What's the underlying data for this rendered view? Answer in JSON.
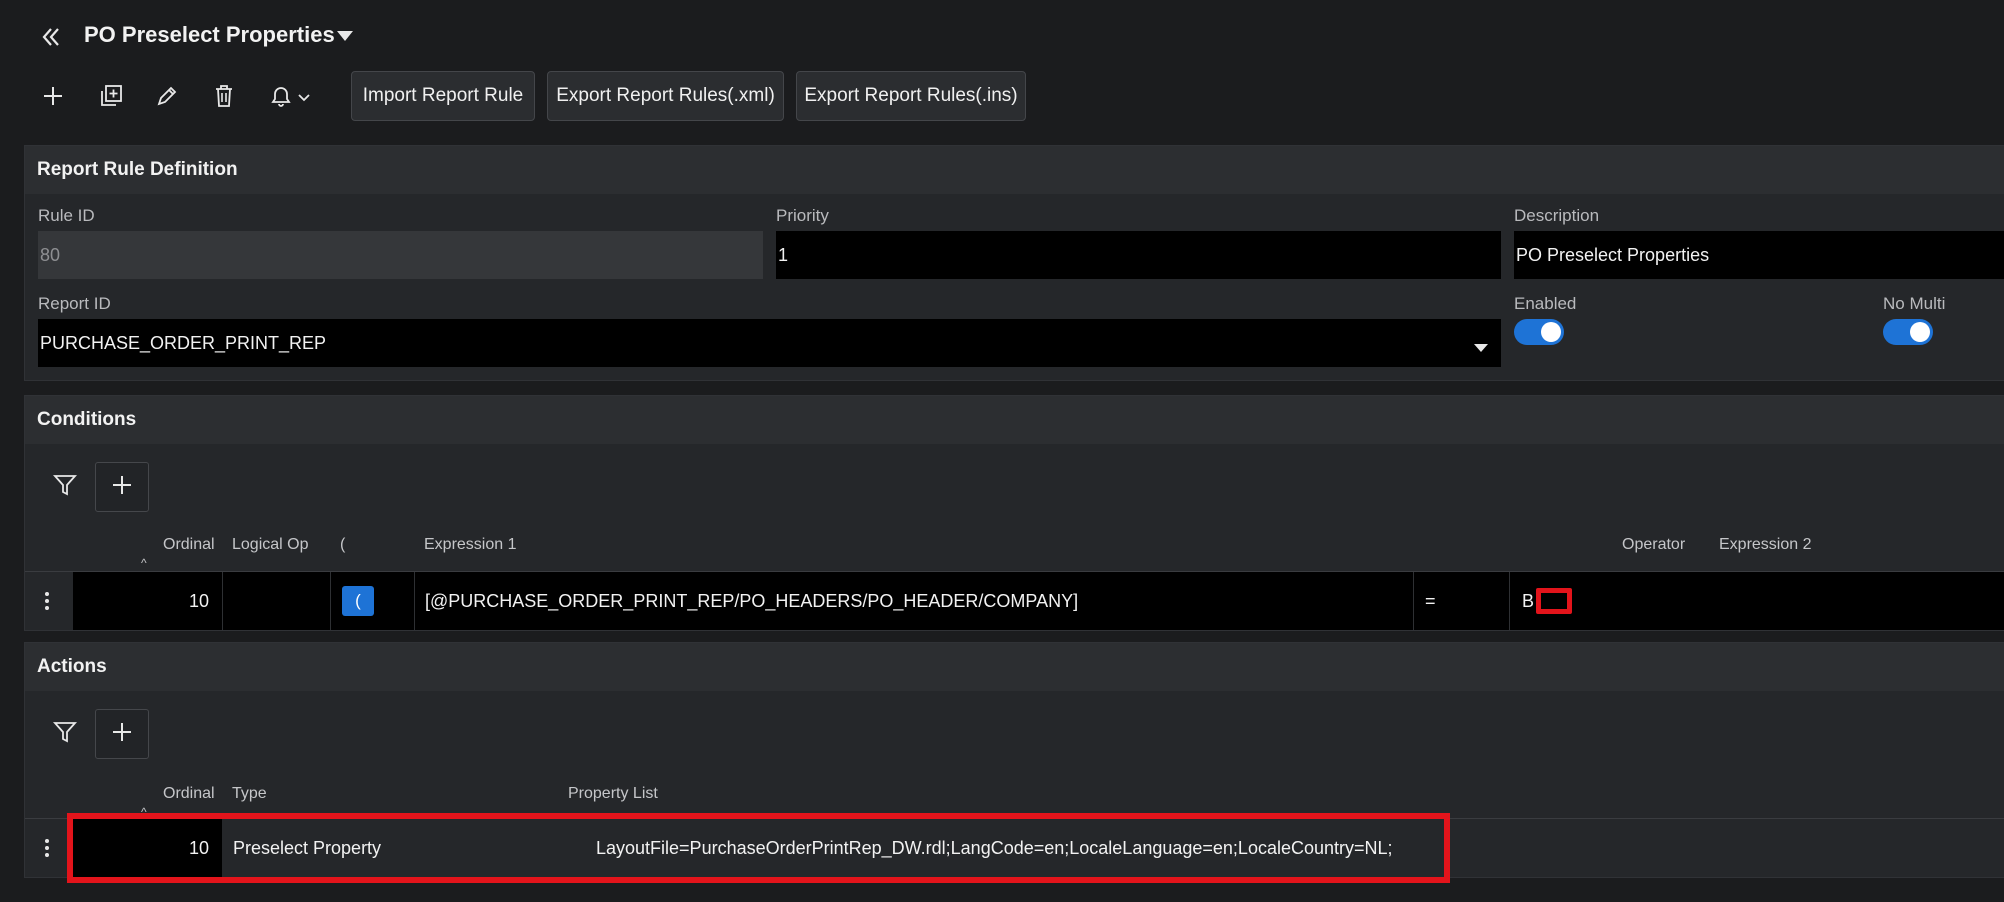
{
  "header": {
    "title": "PO Preselect Properties"
  },
  "toolbar": {
    "import_label": "Import Report Rule",
    "export_xml_label": "Export Report Rules(.xml)",
    "export_ins_label": "Export Report Rules(.ins)"
  },
  "definition": {
    "title": "Report Rule Definition",
    "rule_id_label": "Rule ID",
    "rule_id_value": "80",
    "priority_label": "Priority",
    "priority_value": "1",
    "description_label": "Description",
    "description_value": "PO Preselect Properties",
    "report_id_label": "Report ID",
    "report_id_value": "PURCHASE_ORDER_PRINT_REP",
    "enabled_label": "Enabled",
    "enabled_state": "on",
    "no_multi_label": "No Multi",
    "no_multi_state": "on"
  },
  "conditions": {
    "title": "Conditions",
    "columns": [
      "Ordinal",
      "Logical Op",
      "(",
      "Expression 1",
      "Operator",
      "Expression 2"
    ],
    "rows": [
      {
        "ordinal": "10",
        "logical_op": "",
        "paren": "(",
        "expression1": "[@PURCHASE_ORDER_PRINT_REP/PO_HEADERS/PO_HEADER/COMPANY]",
        "operator": "=",
        "expression2": "B"
      }
    ]
  },
  "actions": {
    "title": "Actions",
    "columns": [
      "Ordinal",
      "Type",
      "Property List"
    ],
    "rows": [
      {
        "ordinal": "10",
        "type": "Preselect Property",
        "property_list": "LayoutFile=PurchaseOrderPrintRep_DW.rdl;LangCode=en;LocaleLanguage=en;LocaleCountry=NL;"
      }
    ]
  },
  "colors": {
    "accent": "#1e73d6",
    "highlight": "#e3141b",
    "field_bg": "#000000",
    "panel_bg": "#25272a"
  }
}
